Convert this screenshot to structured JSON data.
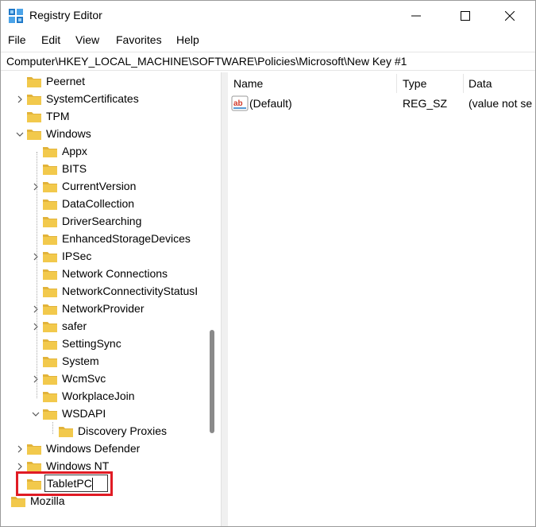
{
  "window": {
    "title": "Registry Editor",
    "icon": "registry-editor-icon"
  },
  "menu": [
    "File",
    "Edit",
    "View",
    "Favorites",
    "Help"
  ],
  "address": "Computer\\HKEY_LOCAL_MACHINE\\SOFTWARE\\Policies\\Microsoft\\New Key #1",
  "tree": {
    "items": [
      {
        "label": "Peernet",
        "expandable": false
      },
      {
        "label": "SystemCertificates",
        "expandable": true
      },
      {
        "label": "TPM",
        "expandable": false
      },
      {
        "label": "Windows",
        "expandable": true,
        "expanded": true
      },
      {
        "label": "Appx",
        "expandable": false
      },
      {
        "label": "BITS",
        "expandable": false
      },
      {
        "label": "CurrentVersion",
        "expandable": true
      },
      {
        "label": "DataCollection",
        "expandable": false
      },
      {
        "label": "DriverSearching",
        "expandable": false
      },
      {
        "label": "EnhancedStorageDevices",
        "expandable": false
      },
      {
        "label": "IPSec",
        "expandable": true
      },
      {
        "label": "Network Connections",
        "expandable": false
      },
      {
        "label": "NetworkConnectivityStatusI",
        "expandable": false
      },
      {
        "label": "NetworkProvider",
        "expandable": true
      },
      {
        "label": "safer",
        "expandable": true
      },
      {
        "label": "SettingSync",
        "expandable": false
      },
      {
        "label": "System",
        "expandable": false
      },
      {
        "label": "WcmSvc",
        "expandable": true
      },
      {
        "label": "WorkplaceJoin",
        "expandable": false
      },
      {
        "label": "WSDAPI",
        "expandable": true,
        "expanded": true
      },
      {
        "label": "Discovery Proxies",
        "expandable": false
      },
      {
        "label": "Windows Defender",
        "expandable": true
      },
      {
        "label": "Windows NT",
        "expandable": true
      },
      {
        "label": "TabletPC",
        "expandable": false,
        "editing": true
      },
      {
        "label": "Mozilla",
        "expandable": true
      }
    ]
  },
  "list": {
    "columns": [
      "Name",
      "Type",
      "Data"
    ],
    "rows": [
      {
        "name": "(Default)",
        "type": "REG_SZ",
        "data": "(value not se"
      }
    ]
  },
  "colors": {
    "folder": "#f2c94c",
    "folder_dark": "#e2b33a",
    "highlight": "#e01b24",
    "scrollbar": "#8a8a8a"
  }
}
